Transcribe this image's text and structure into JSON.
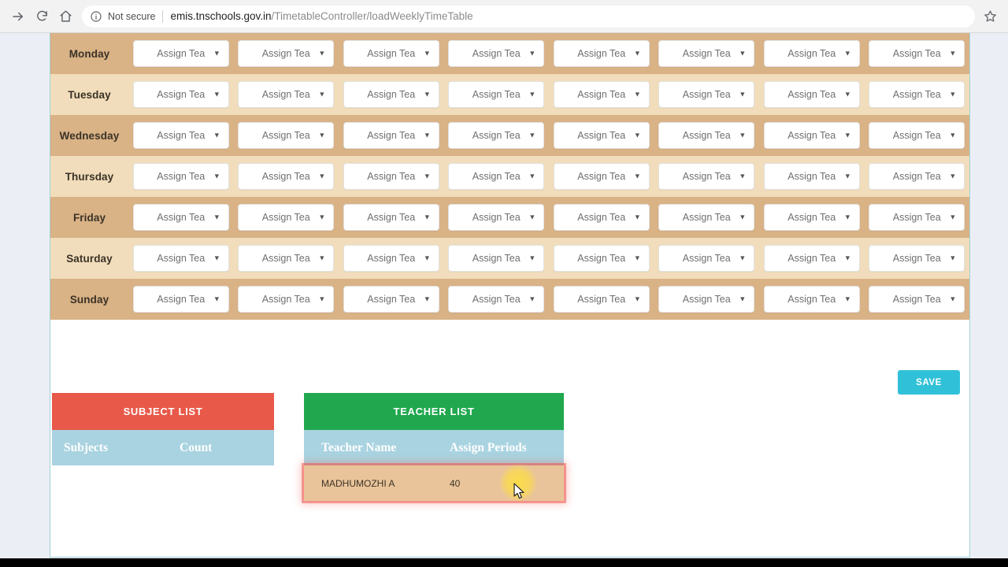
{
  "browser": {
    "back_icon": "arrow-right-icon",
    "reload_icon": "reload-icon",
    "home_icon": "home-icon",
    "info_icon": "info-circle-icon",
    "security_label": "Not secure",
    "url_host": "emis.tnschools.gov.in",
    "url_path": "/TimetableController/loadWeeklyTimeTable",
    "star_icon": "star-bookmark-icon"
  },
  "timetable": {
    "days": [
      "Monday",
      "Tuesday",
      "Wednesday",
      "Thursday",
      "Friday",
      "Saturday",
      "Sunday"
    ],
    "period_count": 8,
    "dropdown_label": "Assign Tea",
    "dropdown_caret": "▼",
    "row_color_dark": "#d9b286",
    "row_color_light": "#f1ddbb"
  },
  "toolbar": {
    "save_label": "SAVE",
    "save_color": "#30c1d8"
  },
  "subject_list": {
    "title": "SUBJECT LIST",
    "title_color": "#e8594a",
    "columns": [
      "Subjects",
      "Count"
    ],
    "rows": []
  },
  "teacher_list": {
    "title": "TEACHER LIST",
    "title_color": "#21a84f",
    "columns": [
      "Teacher Name",
      "Assign Periods"
    ],
    "rows": [
      {
        "name": "MADHUMOZHI A",
        "periods": "40"
      }
    ],
    "highlight_color": "#f05a50"
  }
}
